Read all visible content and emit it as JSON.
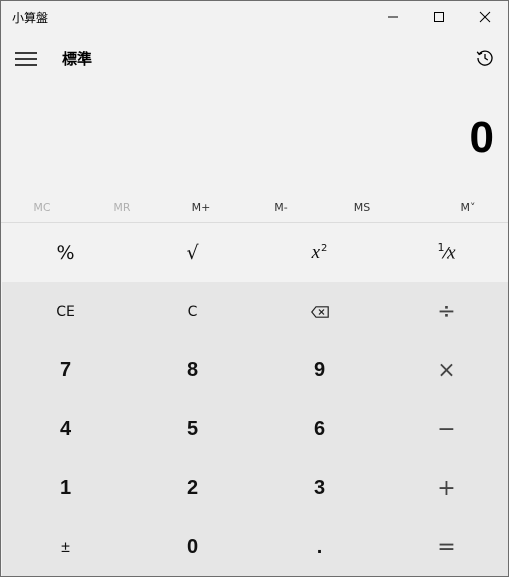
{
  "window": {
    "title": "小算盤"
  },
  "header": {
    "mode": "標準"
  },
  "display": {
    "value": "0"
  },
  "memory": [
    "MC",
    "MR",
    "M+",
    "M-",
    "MS",
    "M˅"
  ],
  "keys": {
    "percent": "%",
    "sqrt": "√",
    "square_base": "x",
    "square_exp": "2",
    "recip_num": "1",
    "recip_den": "x",
    "ce": "CE",
    "c": "C",
    "divide": "÷",
    "n7": "7",
    "n8": "8",
    "n9": "9",
    "multiply": "×",
    "n4": "4",
    "n5": "5",
    "n6": "6",
    "minus": "−",
    "n1": "1",
    "n2": "2",
    "n3": "3",
    "plus": "+",
    "negate": "±",
    "n0": "0",
    "dot": ".",
    "equals": "="
  },
  "icons": {
    "minimize": "minimize-icon",
    "maximize": "maximize-icon",
    "close": "close-icon",
    "menu": "hamburger-menu-icon",
    "history": "history-icon",
    "backspace": "backspace-icon"
  }
}
